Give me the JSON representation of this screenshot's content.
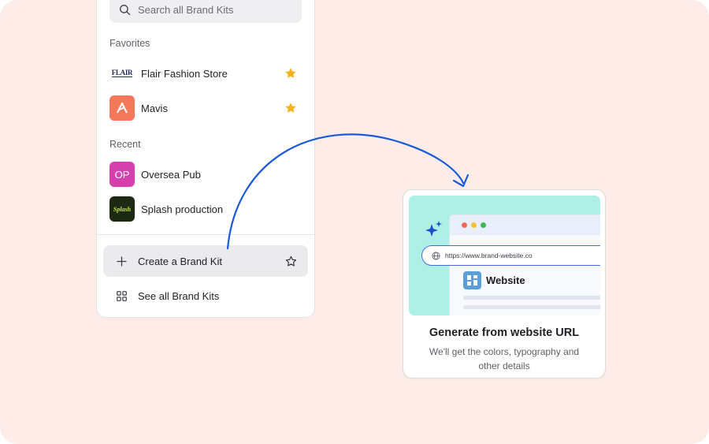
{
  "search": {
    "placeholder": "Search all Brand Kits"
  },
  "favorites": {
    "title": "Favorites",
    "items": [
      {
        "label": "Flair Fashion Store",
        "logo_text": "FLAIR",
        "starred": true
      },
      {
        "label": "Mavis",
        "starred": true
      }
    ]
  },
  "recent": {
    "title": "Recent",
    "items": [
      {
        "label": "Oversea Pub",
        "logo_text": "OP"
      },
      {
        "label": "Splash production",
        "logo_text": "Splash"
      }
    ]
  },
  "actions": {
    "create_label": "Create a Brand Kit",
    "see_all_label": "See all Brand Kits"
  },
  "card": {
    "url": "https://www.brand-website.co",
    "site_name": "Website",
    "title": "Generate from website URL",
    "description": "We'll get the colors, typography and other details"
  },
  "colors": {
    "background": "#fdece8",
    "star": "#f6b21b",
    "arrow": "#1b5ad6",
    "preview_bg": "#aef0e6"
  },
  "icons": [
    "search-icon",
    "star-icon",
    "plus-icon",
    "star-outline-icon",
    "grid-icon",
    "sparkle-icon",
    "globe-icon"
  ]
}
